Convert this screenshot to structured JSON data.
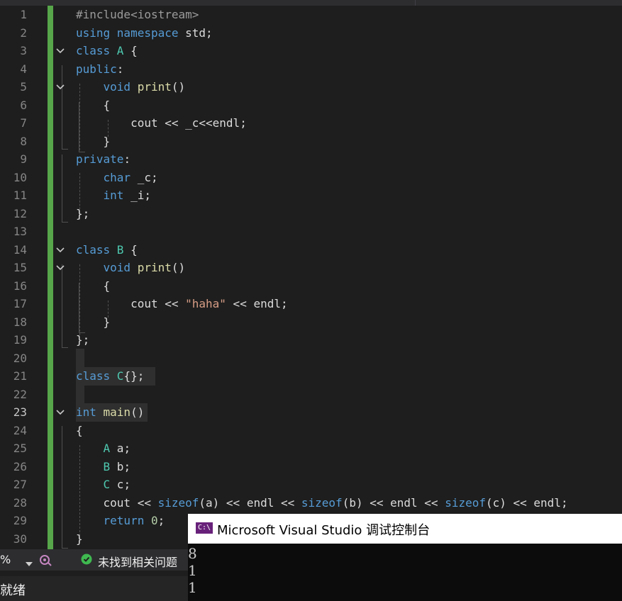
{
  "editor": {
    "current_line": 23,
    "lines": [
      {
        "n": 1,
        "tokens": [
          {
            "t": "#include<iostream>",
            "c": "mac"
          }
        ]
      },
      {
        "n": 2,
        "tokens": [
          {
            "t": "using ",
            "c": "kw"
          },
          {
            "t": "namespace ",
            "c": "kw"
          },
          {
            "t": "std;",
            "c": "pl"
          }
        ]
      },
      {
        "n": 3,
        "tokens": [
          {
            "t": "class ",
            "c": "kw"
          },
          {
            "t": "A",
            "c": "ty"
          },
          {
            "t": " {",
            "c": "pl"
          }
        ]
      },
      {
        "n": 4,
        "tokens": [
          {
            "t": "public",
            "c": "kw"
          },
          {
            "t": ":",
            "c": "pl"
          }
        ]
      },
      {
        "n": 5,
        "tokens": [
          {
            "t": "    "
          },
          {
            "t": "void ",
            "c": "kw"
          },
          {
            "t": "print",
            "c": "fn"
          },
          {
            "t": "()",
            "c": "pl"
          }
        ]
      },
      {
        "n": 6,
        "tokens": [
          {
            "t": "    {",
            "c": "pl"
          }
        ]
      },
      {
        "n": 7,
        "tokens": [
          {
            "t": "        cout << _c<<endl;",
            "c": "pl"
          }
        ]
      },
      {
        "n": 8,
        "tokens": [
          {
            "t": "    }",
            "c": "pl"
          }
        ]
      },
      {
        "n": 9,
        "tokens": [
          {
            "t": "private",
            "c": "kw"
          },
          {
            "t": ":",
            "c": "pl"
          }
        ]
      },
      {
        "n": 10,
        "tokens": [
          {
            "t": "    "
          },
          {
            "t": "char ",
            "c": "kw"
          },
          {
            "t": "_c;",
            "c": "pl"
          }
        ]
      },
      {
        "n": 11,
        "tokens": [
          {
            "t": "    "
          },
          {
            "t": "int ",
            "c": "kw"
          },
          {
            "t": "_i;",
            "c": "pl"
          }
        ]
      },
      {
        "n": 12,
        "tokens": [
          {
            "t": "};",
            "c": "pl"
          }
        ]
      },
      {
        "n": 13,
        "tokens": []
      },
      {
        "n": 14,
        "tokens": [
          {
            "t": "class ",
            "c": "kw"
          },
          {
            "t": "B",
            "c": "ty"
          },
          {
            "t": " {",
            "c": "pl"
          }
        ]
      },
      {
        "n": 15,
        "tokens": [
          {
            "t": "    "
          },
          {
            "t": "void ",
            "c": "kw"
          },
          {
            "t": "print",
            "c": "fn"
          },
          {
            "t": "()",
            "c": "pl"
          }
        ]
      },
      {
        "n": 16,
        "tokens": [
          {
            "t": "    {",
            "c": "pl"
          }
        ]
      },
      {
        "n": 17,
        "tokens": [
          {
            "t": "        cout << ",
            "c": "pl"
          },
          {
            "t": "\"haha\"",
            "c": "str"
          },
          {
            "t": " << endl;",
            "c": "pl"
          }
        ]
      },
      {
        "n": 18,
        "tokens": [
          {
            "t": "    }",
            "c": "pl"
          }
        ]
      },
      {
        "n": 19,
        "tokens": [
          {
            "t": "};",
            "c": "pl"
          }
        ]
      },
      {
        "n": 20,
        "tokens": []
      },
      {
        "n": 21,
        "tokens": [
          {
            "t": "class ",
            "c": "kw"
          },
          {
            "t": "C",
            "c": "ty"
          },
          {
            "t": "{};",
            "c": "pl"
          }
        ]
      },
      {
        "n": 22,
        "tokens": []
      },
      {
        "n": 23,
        "tokens": [
          {
            "t": "int ",
            "c": "kw"
          },
          {
            "t": "main",
            "c": "fn"
          },
          {
            "t": "()",
            "c": "pl"
          }
        ]
      },
      {
        "n": 24,
        "tokens": [
          {
            "t": "{",
            "c": "pl"
          }
        ]
      },
      {
        "n": 25,
        "tokens": [
          {
            "t": "    "
          },
          {
            "t": "A",
            "c": "ty"
          },
          {
            "t": " a;",
            "c": "pl"
          }
        ]
      },
      {
        "n": 26,
        "tokens": [
          {
            "t": "    "
          },
          {
            "t": "B",
            "c": "ty"
          },
          {
            "t": " b;",
            "c": "pl"
          }
        ]
      },
      {
        "n": 27,
        "tokens": [
          {
            "t": "    "
          },
          {
            "t": "C",
            "c": "ty"
          },
          {
            "t": " c;",
            "c": "pl"
          }
        ]
      },
      {
        "n": 28,
        "tokens": [
          {
            "t": "    cout << ",
            "c": "pl"
          },
          {
            "t": "sizeof",
            "c": "kw"
          },
          {
            "t": "(a) << endl << ",
            "c": "pl"
          },
          {
            "t": "sizeof",
            "c": "kw"
          },
          {
            "t": "(b) << endl << ",
            "c": "pl"
          },
          {
            "t": "sizeof",
            "c": "kw"
          },
          {
            "t": "(c) << endl;",
            "c": "pl"
          }
        ]
      },
      {
        "n": 29,
        "tokens": [
          {
            "t": "    "
          },
          {
            "t": "return ",
            "c": "kw"
          },
          {
            "t": "0",
            "c": "num"
          },
          {
            "t": ";",
            "c": "pl"
          }
        ]
      },
      {
        "n": 30,
        "tokens": [
          {
            "t": "}",
            "c": "pl"
          }
        ]
      }
    ],
    "fold_lines": [
      3,
      5,
      14,
      15,
      23
    ]
  },
  "statusbar": {
    "zoom": "%",
    "issues": "未找到相关问题"
  },
  "footer": {
    "ready": "就绪"
  },
  "console": {
    "icon_text": "C:\\",
    "title": "Microsoft Visual Studio 调试控制台",
    "output": [
      "8",
      "1",
      "1"
    ]
  },
  "colors": {
    "keyword": "#569cd6",
    "type": "#4ec9b0",
    "function": "#dcdcaa",
    "string": "#d69d85",
    "number": "#b5cea8",
    "change_bar": "#57a64a"
  }
}
